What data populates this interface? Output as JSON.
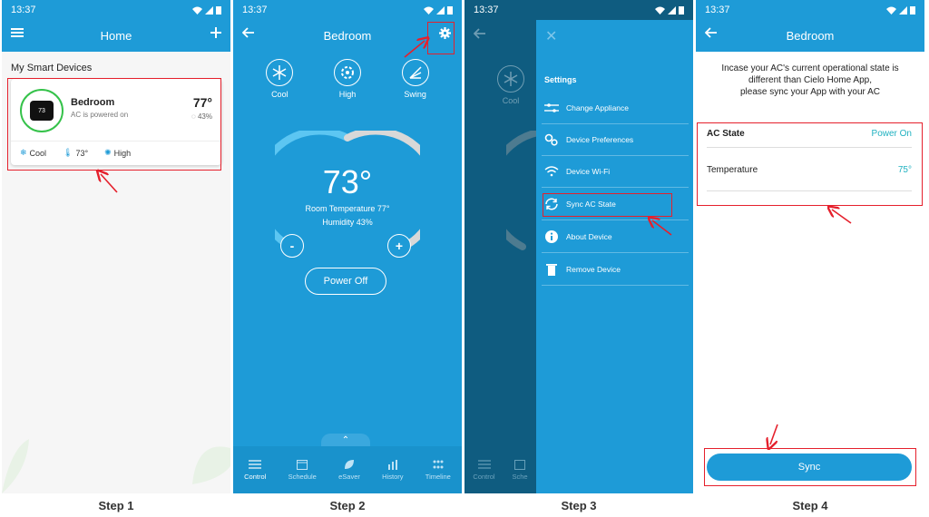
{
  "status_time": "13:37",
  "steps": [
    "Step 1",
    "Step 2",
    "Step 3",
    "Step 4"
  ],
  "colors": {
    "primary": "#1e9bd7",
    "highlight": "#e5202c",
    "accent_value": "#1fb1c0",
    "ring_green": "#35c24a"
  },
  "step1": {
    "title": "Home",
    "section": "My Smart Devices",
    "device": {
      "display": "73",
      "name": "Bedroom",
      "status": "AC is powered on",
      "temp": "77°",
      "humidity": "43%",
      "mode": "Cool",
      "setpoint": "73°",
      "fan": "High"
    }
  },
  "step2": {
    "title": "Bedroom",
    "modes": [
      {
        "label": "Cool",
        "icon": "snowflake-icon"
      },
      {
        "label": "High",
        "icon": "fan-icon"
      },
      {
        "label": "Swing",
        "icon": "swing-icon"
      }
    ],
    "setpoint": "73°",
    "room_temperature": "Room Temperature 77°",
    "humidity": "Humidity 43%",
    "decrease": "-",
    "increase": "+",
    "power_button": "Power Off",
    "nav": [
      "Control",
      "Schedule",
      "eSaver",
      "History",
      "Timeline"
    ]
  },
  "step3": {
    "settings_title": "Settings",
    "items": [
      {
        "label": "Change Appliance",
        "icon": "sliders-icon"
      },
      {
        "label": "Device Preferences",
        "icon": "gears-icon"
      },
      {
        "label": "Device Wi-Fi",
        "icon": "wifi-icon"
      },
      {
        "label": "Sync AC State",
        "icon": "sync-icon"
      },
      {
        "label": "About Device",
        "icon": "info-icon"
      },
      {
        "label": "Remove Device",
        "icon": "trash-icon"
      }
    ],
    "bg_mode": "Cool",
    "nav": [
      "Control",
      "Sche"
    ]
  },
  "step4": {
    "title": "Bedroom",
    "intro_lines": [
      "Incase your AC's current operational state is",
      "different than Cielo Home App,",
      "please sync your App with your AC"
    ],
    "ac_state_label": "AC State",
    "ac_state_value": "Power On",
    "temperature_label": "Temperature",
    "temperature_value": "75°",
    "sync_button": "Sync"
  }
}
